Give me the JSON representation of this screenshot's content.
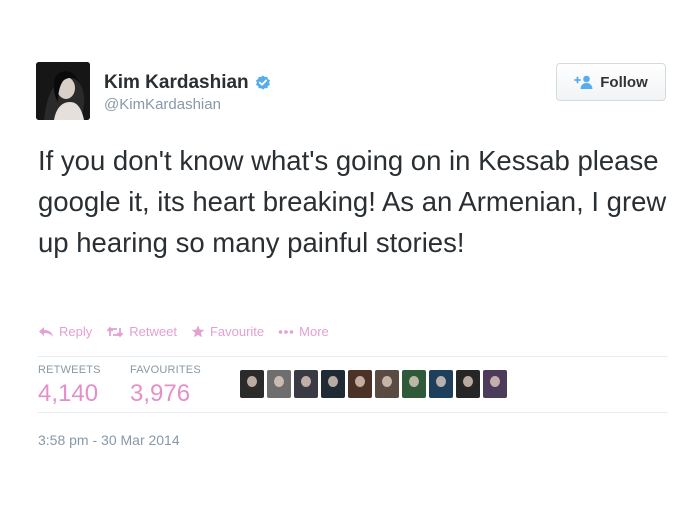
{
  "user": {
    "name": "Kim Kardashian",
    "handle": "@KimKardashian",
    "verified": true
  },
  "follow_button": {
    "label": "Follow",
    "icon": "add-user-icon"
  },
  "tweet": {
    "text": "If you don't know what's going on in Kessab please google it, its heart breaking! As an Armenian, I grew up hearing so many painful stories!",
    "timestamp": "3:58 pm - 30 Mar 2014"
  },
  "actions": [
    {
      "label": "Reply",
      "icon": "reply-icon"
    },
    {
      "label": "Retweet",
      "icon": "retweet-icon"
    },
    {
      "label": "Favourite",
      "icon": "star-icon"
    },
    {
      "label": "More",
      "icon": "more-dots-icon"
    }
  ],
  "stats": {
    "retweets_label": "RETWEETS",
    "retweets_value": "4,140",
    "favourites_label": "FAVOURITES",
    "favourites_value": "3,976"
  },
  "colors": {
    "action_pink": "#e3a0d3",
    "stat_pink": "#e390c9",
    "verified_blue": "#55acee",
    "muted_gray": "#8899a6"
  },
  "favouriters_count": 10
}
